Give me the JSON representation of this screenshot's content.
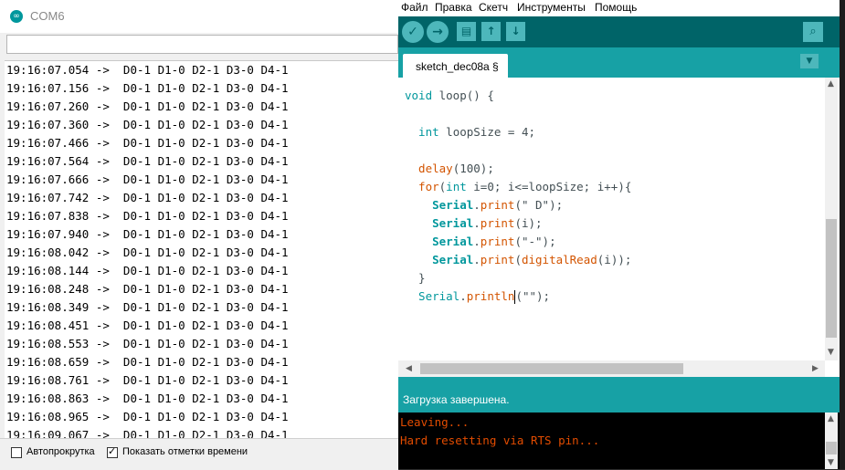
{
  "serial_monitor": {
    "title": "COM6",
    "logo_glyph": "∞",
    "lines": [
      "19:16:07.054 ->  D0-1 D1-0 D2-1 D3-0 D4-1",
      "19:16:07.156 ->  D0-1 D1-0 D2-1 D3-0 D4-1",
      "19:16:07.260 ->  D0-1 D1-0 D2-1 D3-0 D4-1",
      "19:16:07.360 ->  D0-1 D1-0 D2-1 D3-0 D4-1",
      "19:16:07.466 ->  D0-1 D1-0 D2-1 D3-0 D4-1",
      "19:16:07.564 ->  D0-1 D1-0 D2-1 D3-0 D4-1",
      "19:16:07.666 ->  D0-1 D1-0 D2-1 D3-0 D4-1",
      "19:16:07.742 ->  D0-1 D1-0 D2-1 D3-0 D4-1",
      "19:16:07.838 ->  D0-1 D1-0 D2-1 D3-0 D4-1",
      "19:16:07.940 ->  D0-1 D1-0 D2-1 D3-0 D4-1",
      "19:16:08.042 ->  D0-1 D1-0 D2-1 D3-0 D4-1",
      "19:16:08.144 ->  D0-1 D1-0 D2-1 D3-0 D4-1",
      "19:16:08.248 ->  D0-1 D1-0 D2-1 D3-0 D4-1",
      "19:16:08.349 ->  D0-1 D1-0 D2-1 D3-0 D4-1",
      "19:16:08.451 ->  D0-1 D1-0 D2-1 D3-0 D4-1",
      "19:16:08.553 ->  D0-1 D1-0 D2-1 D3-0 D4-1",
      "19:16:08.659 ->  D0-1 D1-0 D2-1 D3-0 D4-1",
      "19:16:08.761 ->  D0-1 D1-0 D2-1 D3-0 D4-1",
      "19:16:08.863 ->  D0-1 D1-0 D2-1 D3-0 D4-1",
      "19:16:08.965 ->  D0-1 D1-0 D2-1 D3-0 D4-1",
      "19:16:09.067 ->  D0-1 D1-0 D2-1 D3-0 D4-1"
    ],
    "autoscroll_label": "Автопрокрутка",
    "autoscroll_checked": false,
    "timestamps_label": "Показать отметки времени",
    "timestamps_checked": true
  },
  "ide": {
    "menu": [
      "Файл",
      "Правка",
      "Скетч",
      "Инструменты",
      "Помощь"
    ],
    "toolbar": {
      "verify_icon": "✓",
      "upload_icon": "→",
      "new_icon": "▤",
      "open_icon": "↑",
      "save_icon": "↓",
      "serial_icon": "⌕"
    },
    "tab_label": "sketch_dec08a §",
    "tab_menu_icon": "▼",
    "code": {
      "l1a": "void",
      "l1b": " loop() {",
      "l3a": "  int",
      "l3b": " loopSize = 4;",
      "l5a": "  delay",
      "l5b": "(100);",
      "l6a": "  for",
      "l6b": "(",
      "l6c": "int",
      "l6d": " i=0; i<=loopSize; i++){",
      "l7a": "    Serial",
      "l7b": ".",
      "l7c": "print",
      "l7d": "(\" D\");",
      "l8a": "    Serial",
      "l8b": ".",
      "l8c": "print",
      "l8d": "(i);",
      "l9a": "    Serial",
      "l9b": ".",
      "l9c": "print",
      "l9d": "(\"-\");",
      "l10a": "    Serial",
      "l10b": ".",
      "l10c": "print",
      "l10d": "(",
      "l10e": "digitalRead",
      "l10f": "(i));",
      "l11": "  }",
      "l12a": "  Serial",
      "l12b": ".",
      "l12c": "println",
      "l12d": "(\"\");"
    },
    "status": "Загрузка завершена.",
    "console": [
      "Leaving...",
      "Hard resetting via RTS pin..."
    ],
    "scroll_up_icon": "▲",
    "scroll_down_icon": "▼",
    "scroll_left_icon": "◀",
    "scroll_right_icon": "▶"
  }
}
